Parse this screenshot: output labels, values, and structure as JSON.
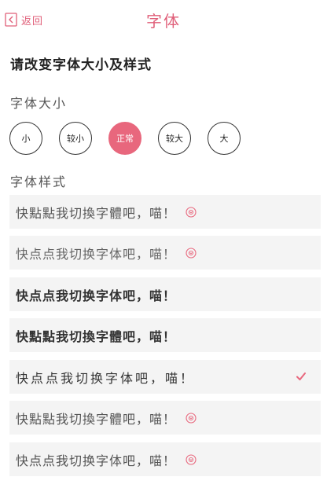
{
  "header": {
    "back_label": "返回",
    "title": "字体"
  },
  "instruction": "请改变字体大小及样式",
  "size_section": {
    "label": "字体大小",
    "options": [
      "小",
      "较小",
      "正常",
      "较大",
      "大"
    ],
    "selected": "正常"
  },
  "style_section": {
    "label": "字体样式",
    "items": [
      {
        "text": "快點點我切換字體吧，喵！",
        "icon": "download-circle-icon"
      },
      {
        "text": "快点点我切换字体吧，喵！",
        "icon": "download-circle-icon"
      },
      {
        "text": "快点点我切换字体吧，喵！",
        "icon": ""
      },
      {
        "text": "快點點我切換字體吧，喵！",
        "icon": ""
      },
      {
        "text": "快点点我切换字体吧，喵！",
        "icon": "check-icon"
      },
      {
        "text": "快點點我切換字體吧，喵！",
        "icon": "download-circle-icon"
      },
      {
        "text": "快点点我切换字体吧，喵！",
        "icon": "download-circle-icon"
      }
    ],
    "selected_index": 4
  },
  "colors": {
    "accent": "#e8677d",
    "item_bg": "#f4f4f4"
  }
}
